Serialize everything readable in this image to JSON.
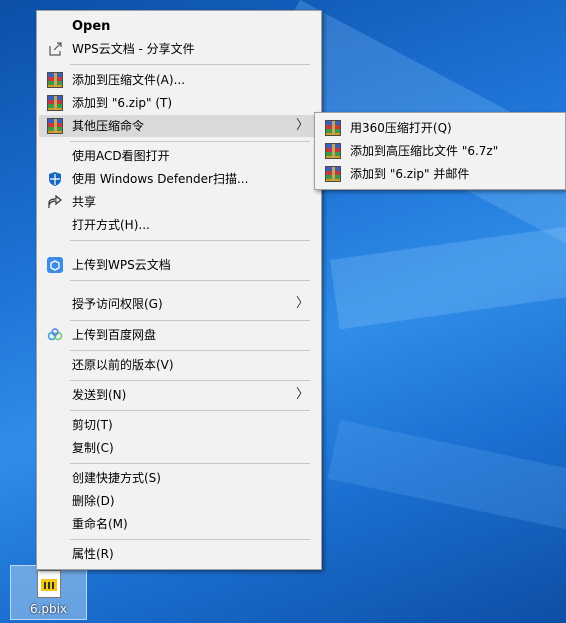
{
  "menu": {
    "items": [
      {
        "label": "Open",
        "icon": "none"
      },
      {
        "label": "WPS云文档 - 分享文件",
        "icon": "share-out-icon"
      },
      {
        "label": "添加到压缩文件(A)...",
        "icon": "winrar-icon"
      },
      {
        "label": "添加到 \"6.zip\" (T)",
        "icon": "winrar-icon"
      },
      {
        "label": "其他压缩命令",
        "icon": "winrar-icon"
      },
      {
        "label": "使用ACD看图打开",
        "icon": "none"
      },
      {
        "label": "使用 Windows Defender扫描...",
        "icon": "defender-shield-icon"
      },
      {
        "label": "共享",
        "icon": "share-icon"
      },
      {
        "label": "打开方式(H)...",
        "icon": "none"
      },
      {
        "label": "上传到WPS云文档",
        "icon": "wps-cloud-icon"
      },
      {
        "label": "授予访问权限(G)",
        "icon": "none"
      },
      {
        "label": "上传到百度网盘",
        "icon": "baidu-cloud-icon"
      },
      {
        "label": "还原以前的版本(V)",
        "icon": "none"
      },
      {
        "label": "发送到(N)",
        "icon": "none"
      },
      {
        "label": "剪切(T)",
        "icon": "none"
      },
      {
        "label": "复制(C)",
        "icon": "none"
      },
      {
        "label": "创建快捷方式(S)",
        "icon": "none"
      },
      {
        "label": "删除(D)",
        "icon": "none"
      },
      {
        "label": "重命名(M)",
        "icon": "none"
      },
      {
        "label": "属性(R)",
        "icon": "none"
      }
    ]
  },
  "submenu": {
    "items": [
      {
        "label": "用360压缩打开(Q)"
      },
      {
        "label": "添加到高压缩比文件 \"6.7z\""
      },
      {
        "label": "添加到 \"6.zip\" 并邮件"
      }
    ]
  },
  "desktop": {
    "file_label": "6.pbix"
  },
  "colors": {
    "menu_bg": "#f2f2f2",
    "hover_bg": "#d9d9d9",
    "desktop_blue": "#1f74d6"
  }
}
